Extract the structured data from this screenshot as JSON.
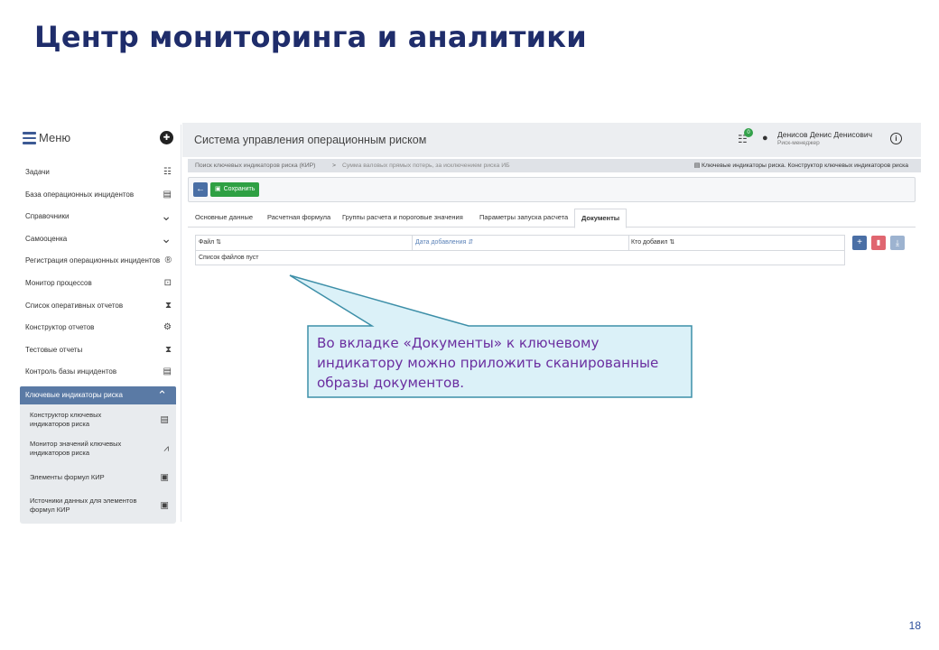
{
  "slide": {
    "title": "Центр мониторинга и аналитики",
    "page_number": "18"
  },
  "sidebar": {
    "menu_label": "Меню",
    "items": [
      {
        "label": "Задачи",
        "icon": "list-check-icon",
        "glyph": "☷"
      },
      {
        "label": "База операционных инцидентов",
        "icon": "table-icon",
        "glyph": "▤"
      },
      {
        "label": "Справочники",
        "icon": "chevron-down-icon",
        "glyph": "⌄"
      },
      {
        "label": "Самооценка",
        "icon": "chevron-down-icon",
        "glyph": "⌄"
      },
      {
        "label": "Регистрация операционных инцидентов",
        "icon": "registered-icon",
        "glyph": "®"
      },
      {
        "label": "Монитор процессов",
        "icon": "monitor-icon",
        "glyph": "⊡"
      },
      {
        "label": "Список оперативных отчетов",
        "icon": "hourglass-icon",
        "glyph": "⧗"
      },
      {
        "label": "Конструктор отчетов",
        "icon": "gears-icon",
        "glyph": "⚙"
      },
      {
        "label": "Тестовые отчеты",
        "icon": "hourglass-icon",
        "glyph": "⧗"
      },
      {
        "label": "Контроль базы инцидентов",
        "icon": "table-icon",
        "glyph": "▤"
      }
    ],
    "active_group": {
      "label": "Ключевые индикаторы риска",
      "glyph": "⌃"
    },
    "sub_items": [
      {
        "label": "Конструктор ключевых индикаторов риска",
        "icon": "table-icon",
        "glyph": "▤"
      },
      {
        "label": "Монитор значений ключевых индикаторов риска",
        "icon": "chart-icon",
        "glyph": "⩘"
      },
      {
        "label": "Элементы формул КИР",
        "icon": "document-icon",
        "glyph": "▣"
      },
      {
        "label": "Источники данных для элементов формул КИР",
        "icon": "document-icon",
        "glyph": "▣"
      }
    ]
  },
  "header": {
    "app_title": "Система управления операционным риском",
    "tasks_badge": "0",
    "user_name": "Денисов Денис Денисович",
    "user_role": "Риск-менеджер"
  },
  "breadcrumb": {
    "item1": "Поиск ключевых индикаторов риска (КИР)",
    "separator": ">",
    "item2": "Сумма валовых прямых потерь, за исключением риска ИБ",
    "right": "▤ Ключевые индикаторы риска. Конструктор ключевых индикаторов риска"
  },
  "toolbar": {
    "save_label": "Сохранить"
  },
  "tabs": [
    {
      "label": "Основные данные"
    },
    {
      "label": "Расчетная формула"
    },
    {
      "label": "Группы расчета и пороговые значения"
    },
    {
      "label": "Параметры запуска расчета"
    },
    {
      "label": "Документы"
    }
  ],
  "table": {
    "columns": [
      "Файл ⇅",
      "Дата добавления ⇵",
      "Кто добавил ⇅"
    ],
    "empty_text": "Список файлов пуст"
  },
  "callout": {
    "text": "Во вкладке «Документы» к ключевому индикатору можно приложить сканированные образы документов."
  },
  "colors": {
    "title": "#1f2d6b",
    "accent_blue": "#4a6fa5",
    "save_green": "#2ea043",
    "delete_red": "#e06670",
    "callout_fill": "#dbf1f8",
    "callout_border": "#3d8fa8",
    "callout_text": "#6b2fa0"
  }
}
